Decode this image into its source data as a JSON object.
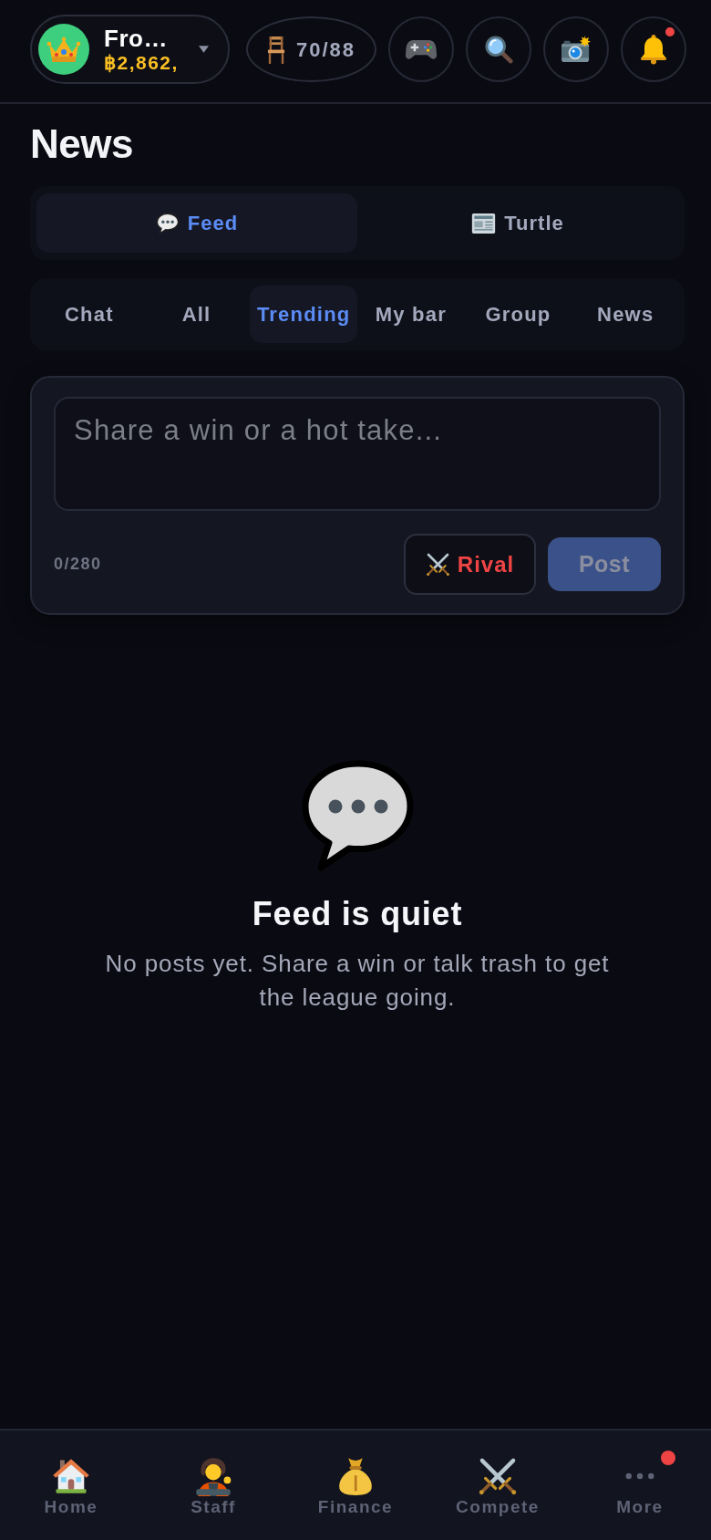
{
  "header": {
    "profile": {
      "name": "Fro…",
      "balance": "฿2,862,"
    },
    "seats": "70/88",
    "buttons": [
      {
        "kind": "games",
        "notification_dot": false
      },
      {
        "kind": "search",
        "notification_dot": false
      },
      {
        "kind": "camera",
        "notification_dot": false
      },
      {
        "kind": "notifications",
        "notification_dot": true
      }
    ]
  },
  "page_title": "News",
  "segments": [
    {
      "label": "Feed",
      "selected": true
    },
    {
      "label": "Turtle",
      "selected": false
    }
  ],
  "filters": [
    {
      "label": "Chat",
      "selected": false
    },
    {
      "label": "All",
      "selected": false
    },
    {
      "label": "Trending",
      "selected": true
    },
    {
      "label": "My bar",
      "selected": false
    },
    {
      "label": "Group",
      "selected": false
    },
    {
      "label": "News",
      "selected": false
    }
  ],
  "composer": {
    "placeholder": "Share a win or a hot take...",
    "counter": "0/280",
    "rival_button": "Rival",
    "post_button": {
      "label": "Post",
      "disabled": true
    }
  },
  "empty_state": {
    "title": "Feed is quiet",
    "message": "No posts yet. Share a win or talk trash to get the league going."
  },
  "bottom_nav": [
    {
      "label": "Home",
      "selected": false,
      "notification_dot": false
    },
    {
      "label": "Staff",
      "selected": false,
      "notification_dot": false
    },
    {
      "label": "Finance",
      "selected": false,
      "notification_dot": false
    },
    {
      "label": "Compete",
      "selected": false,
      "notification_dot": false
    },
    {
      "label": "More",
      "selected": false,
      "notification_dot": true
    }
  ]
}
